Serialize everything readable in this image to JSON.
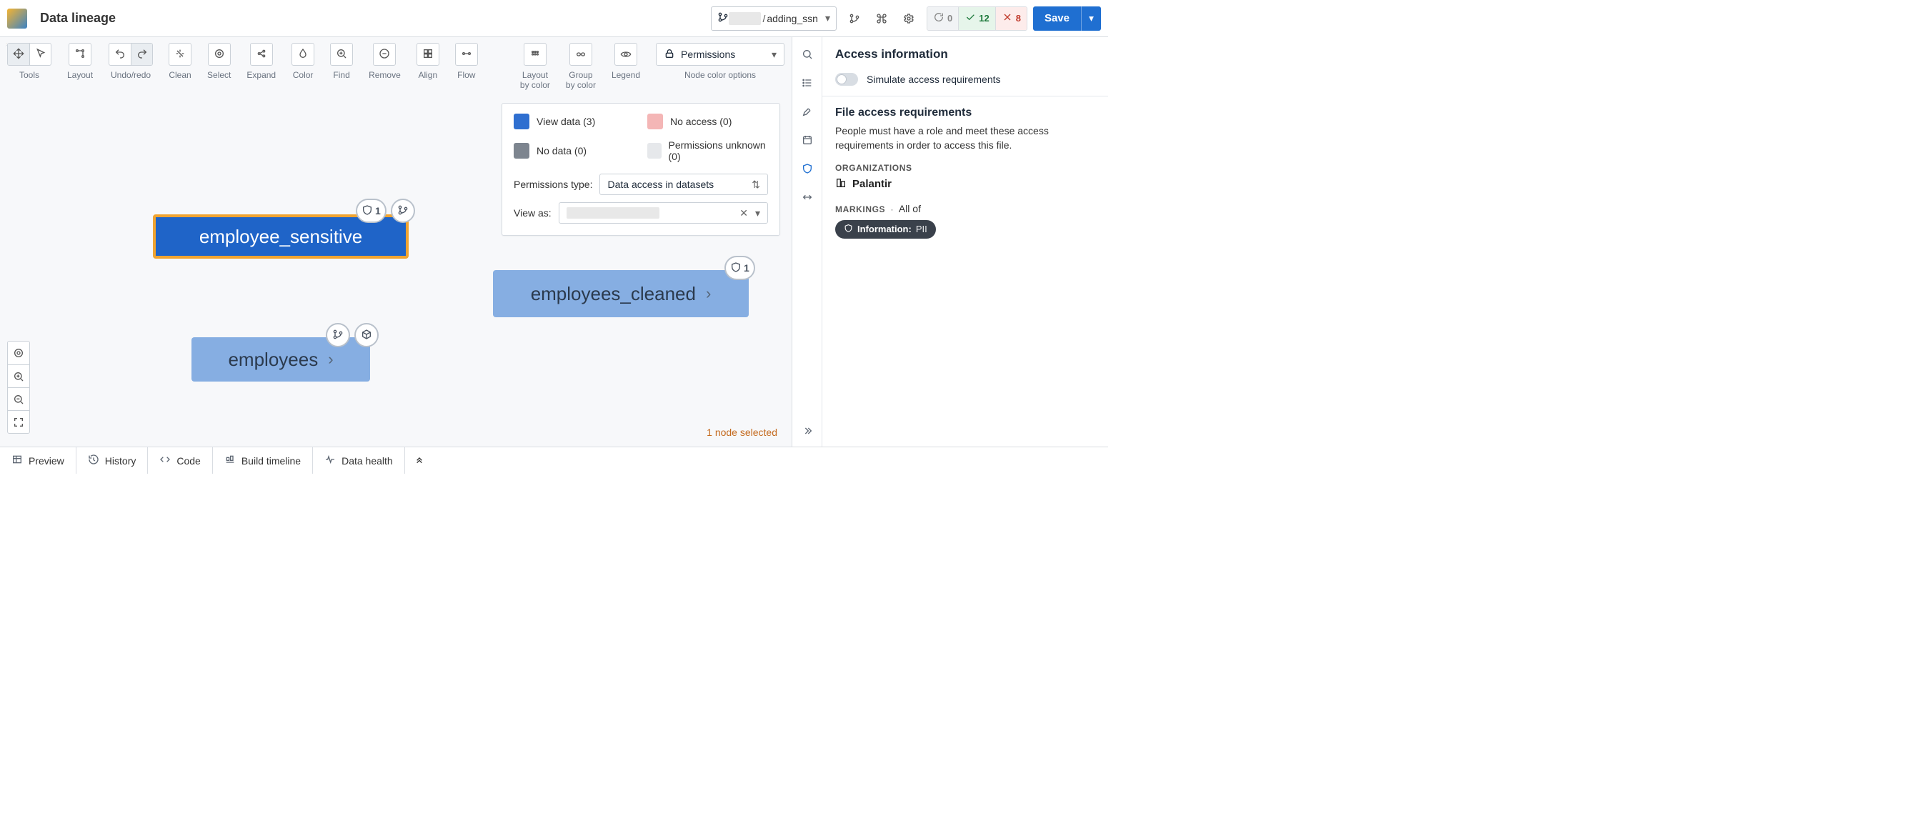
{
  "header": {
    "title": "Data lineage",
    "branch": "adding_ssn",
    "status": {
      "pending": 0,
      "passed": 12,
      "failed": 8
    },
    "save_label": "Save"
  },
  "colors": {
    "brand_blue": "#1f6fd1",
    "selected_orange": "#f0a431",
    "node_light": "#86aee2",
    "swatch_blue": "#2f6fd0",
    "swatch_pink": "#f4b6b6",
    "swatch_gray": "#7d858f",
    "swatch_lightgray": "#e6e8eb"
  },
  "tool_groups": [
    {
      "label": "Tools",
      "icons": [
        "move-icon",
        "pointer-icon"
      ]
    },
    {
      "label": "Layout",
      "icons": [
        "layout-icon"
      ]
    },
    {
      "label": "Undo/redo",
      "icons": [
        "undo-icon",
        "redo-icon"
      ]
    },
    {
      "label": "Clean",
      "icons": [
        "clean-icon"
      ]
    },
    {
      "label": "Select",
      "icons": [
        "target-icon"
      ]
    },
    {
      "label": "Expand",
      "icons": [
        "expand-icon"
      ]
    },
    {
      "label": "Color",
      "icons": [
        "drop-icon"
      ]
    },
    {
      "label": "Find",
      "icons": [
        "find-icon"
      ]
    },
    {
      "label": "Remove",
      "icons": [
        "remove-icon"
      ]
    },
    {
      "label": "Align",
      "icons": [
        "grid-icon"
      ]
    },
    {
      "label": "Flow",
      "icons": [
        "flow-icon"
      ]
    }
  ],
  "right_tools": {
    "layout_by_color_label": "Layout\nby color",
    "group_by_color_label": "Group\nby color",
    "legend_label": "Legend",
    "node_color_options_label": "Node color options",
    "permissions_select": "Permissions"
  },
  "legend": {
    "items": [
      {
        "swatch": "sw-blue",
        "text": "View data (3)"
      },
      {
        "swatch": "sw-pink",
        "text": "No access (0)"
      },
      {
        "swatch": "sw-gray",
        "text": "No data (0)"
      },
      {
        "swatch": "sw-lgray",
        "text": "Permissions unknown (0)"
      }
    ],
    "permissions_type_label": "Permissions type:",
    "permissions_type_value": "Data access in datasets",
    "view_as_label": "View as:"
  },
  "nodes": {
    "employee_sensitive": {
      "label": "employee_sensitive",
      "badge_count": 1
    },
    "employees_cleaned": {
      "label": "employees_cleaned",
      "badge_count": 1
    },
    "employees": {
      "label": "employees"
    }
  },
  "selection_text": "1 node selected",
  "right_panel": {
    "title": "Access information",
    "simulate_label": "Simulate access requirements",
    "file_access_hdr": "File access requirements",
    "file_access_desc": "People must have a role and meet these access requirements in order to access this file.",
    "organizations_hdr": "ORGANIZATIONS",
    "organization_name": "Palantir",
    "markings_hdr": "MARKINGS",
    "markings_qualifier": "All of",
    "marking_pill_key": "Information:",
    "marking_pill_val": "PII"
  },
  "bottom_tabs": [
    {
      "icon": "table-icon",
      "label": "Preview"
    },
    {
      "icon": "history-icon",
      "label": "History"
    },
    {
      "icon": "code-icon",
      "label": "Code"
    },
    {
      "icon": "timeline-icon",
      "label": "Build timeline"
    },
    {
      "icon": "health-icon",
      "label": "Data health"
    }
  ]
}
